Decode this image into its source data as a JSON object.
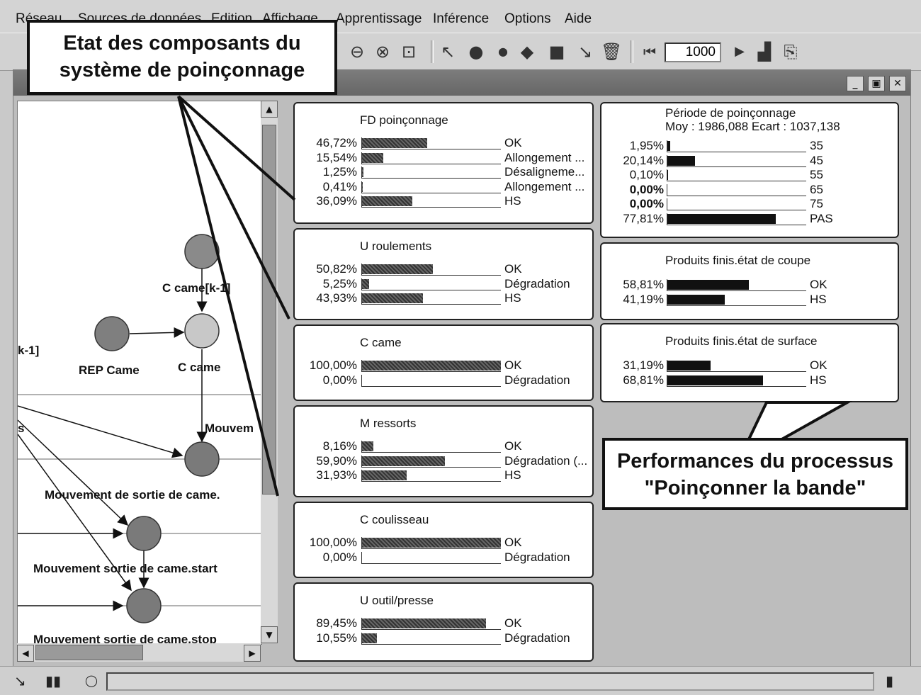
{
  "menu": [
    "Réseau",
    "Sources de données",
    "Edition",
    "Affichage",
    "Apprentissage",
    "Inférence",
    "Options",
    "Aide"
  ],
  "toolbar": {
    "iterations": "1000",
    "icons": [
      "zoom-out-icon",
      "zoom-fit-icon",
      "select-area-icon",
      "pointer-icon",
      "node-icon",
      "small-node-icon",
      "decision-icon",
      "utility-icon",
      "arrow-icon",
      "delete-icon",
      "first-icon",
      "play-icon",
      "histogram-icon",
      "attach-icon"
    ]
  },
  "window": {
    "buttons": [
      "minimize",
      "restore",
      "close"
    ]
  },
  "network": {
    "labels": {
      "c_came_prev": "C came[k-1]",
      "rep_came": "REP Came",
      "c_came": "C came",
      "k1_cut": "k-1]",
      "mouvem": "Mouvem",
      "s_cut": "s",
      "mvt_sortie": "Mouvement de sortie de came.",
      "mvt_start": "Mouvement sortie de came.start",
      "mvt_stop": "Mouvement sortie de came.stop"
    }
  },
  "monitors_left": [
    {
      "title": "FD poinçonnage",
      "rows": [
        {
          "pct": "46,72%",
          "value": 46.72,
          "label": "OK"
        },
        {
          "pct": "15,54%",
          "value": 15.54,
          "label": "Allongement ..."
        },
        {
          "pct": "1,25%",
          "value": 1.25,
          "label": "Désaligneme..."
        },
        {
          "pct": "0,41%",
          "value": 0.41,
          "label": "Allongement ..."
        },
        {
          "pct": "36,09%",
          "value": 36.09,
          "label": "HS"
        }
      ]
    },
    {
      "title": "U roulements",
      "rows": [
        {
          "pct": "50,82%",
          "value": 50.82,
          "label": "OK"
        },
        {
          "pct": "5,25%",
          "value": 5.25,
          "label": "Dégradation"
        },
        {
          "pct": "43,93%",
          "value": 43.93,
          "label": "HS"
        }
      ]
    },
    {
      "title": "C came",
      "rows": [
        {
          "pct": "100,00%",
          "value": 100,
          "label": "OK"
        },
        {
          "pct": "0,00%",
          "value": 0,
          "label": "Dégradation"
        }
      ]
    },
    {
      "title": "M ressorts",
      "rows": [
        {
          "pct": "8,16%",
          "value": 8.16,
          "label": "OK"
        },
        {
          "pct": "59,90%",
          "value": 59.9,
          "label": "Dégradation (..."
        },
        {
          "pct": "31,93%",
          "value": 31.93,
          "label": "HS"
        }
      ]
    },
    {
      "title": "C coulisseau",
      "rows": [
        {
          "pct": "100,00%",
          "value": 100,
          "label": "OK"
        },
        {
          "pct": "0,00%",
          "value": 0,
          "label": "Dégradation"
        }
      ]
    },
    {
      "title": "U outil/presse",
      "rows": [
        {
          "pct": "89,45%",
          "value": 89.45,
          "label": "OK"
        },
        {
          "pct": "10,55%",
          "value": 10.55,
          "label": "Dégradation"
        }
      ]
    }
  ],
  "monitors_right": [
    {
      "title": "Période de poinçonnage",
      "subtitle": "Moy : 1986,088 Ecart : 1037,138",
      "rows": [
        {
          "pct": "1,95%",
          "value": 1.95,
          "label": "35",
          "bold": false
        },
        {
          "pct": "20,14%",
          "value": 20.14,
          "label": "45",
          "bold": false
        },
        {
          "pct": "0,10%",
          "value": 0.1,
          "label": "55",
          "bold": false
        },
        {
          "pct": "0,00%",
          "value": 0,
          "label": "65",
          "bold": true
        },
        {
          "pct": "0,00%",
          "value": 0,
          "label": "75",
          "bold": true
        },
        {
          "pct": "77,81%",
          "value": 77.81,
          "label": "PAS",
          "bold": false
        }
      ]
    },
    {
      "title": "Produits finis.état de coupe",
      "subtitle": "",
      "rows": [
        {
          "pct": "58,81%",
          "value": 58.81,
          "label": "OK",
          "bold": false
        },
        {
          "pct": "41,19%",
          "value": 41.19,
          "label": "HS",
          "bold": false
        }
      ]
    },
    {
      "title": "Produits finis.état de surface",
      "subtitle": "",
      "rows": [
        {
          "pct": "31,19%",
          "value": 31.19,
          "label": "OK",
          "bold": false
        },
        {
          "pct": "68,81%",
          "value": 68.81,
          "label": "HS",
          "bold": false
        }
      ]
    }
  ],
  "callouts": {
    "etat": [
      "Etat des composants du",
      "système de poinçonnage"
    ],
    "perf": [
      "Performances du processus",
      "\"Poinçonner la bande\""
    ]
  }
}
